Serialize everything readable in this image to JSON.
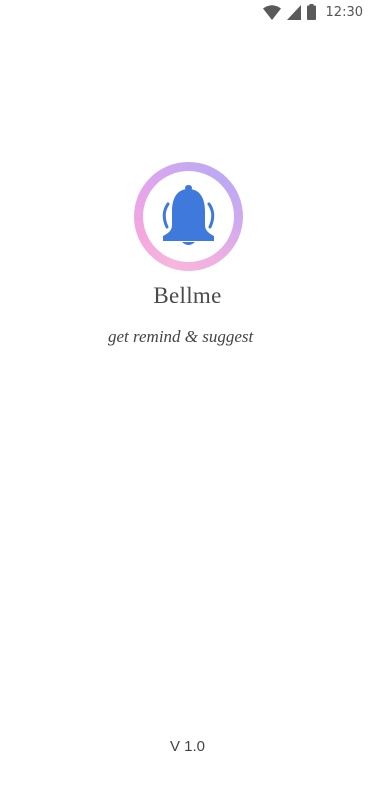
{
  "status_bar": {
    "time": "12:30",
    "icons": [
      "wifi-icon",
      "cellular-signal-icon",
      "battery-icon"
    ]
  },
  "splash": {
    "logo_icon": "bell-ringing-icon",
    "app_name": "Bellme",
    "tagline": "get remind & suggest",
    "version": "V 1.0"
  },
  "colors": {
    "bell": "#3f79dc",
    "ring_gradient": [
      "#f6b6dd",
      "#e2a5ec",
      "#bca9f2"
    ],
    "background": "#ffffff"
  }
}
